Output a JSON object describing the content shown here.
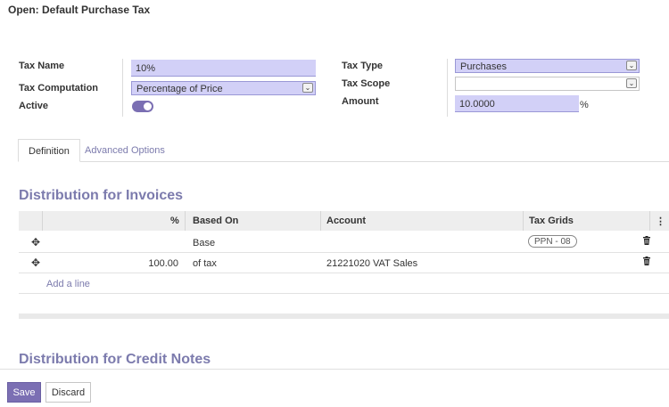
{
  "page": {
    "title": "Open: Default Purchase Tax"
  },
  "form": {
    "tax_name_label": "Tax Name",
    "tax_name_value": "10%",
    "tax_computation_label": "Tax Computation",
    "tax_computation_value": "Percentage of Price",
    "active_label": "Active",
    "active_value": true,
    "tax_type_label": "Tax Type",
    "tax_type_value": "Purchases",
    "tax_scope_label": "Tax Scope",
    "tax_scope_value": "",
    "amount_label": "Amount",
    "amount_value": "10.0000",
    "amount_unit": "%"
  },
  "tabs": [
    {
      "label": "Definition",
      "active": true
    },
    {
      "label": "Advanced Options",
      "active": false
    }
  ],
  "invoices": {
    "title": "Distribution for Invoices",
    "columns": [
      "%",
      "Based On",
      "Account",
      "Tax Grids"
    ],
    "rows": [
      {
        "percent": "",
        "based_on": "Base",
        "account": "",
        "tax_grid": "PPN - 08"
      },
      {
        "percent": "100.00",
        "based_on": "of tax",
        "account": "21221020 VAT Sales",
        "tax_grid": ""
      }
    ],
    "add_line": "Add a line"
  },
  "credit_notes": {
    "title": "Distribution for Credit Notes"
  },
  "footer": {
    "save_label": "Save",
    "discard_label": "Discard"
  },
  "colors": {
    "accent": "#7b6fb3",
    "field_bg": "#d2d0f7",
    "link": "#7c7bad"
  },
  "icons": {
    "drag": "move-handle-icon",
    "trash": "trash-icon",
    "caret": "chevron-down-icon",
    "column_menu": "kebab-icon"
  }
}
